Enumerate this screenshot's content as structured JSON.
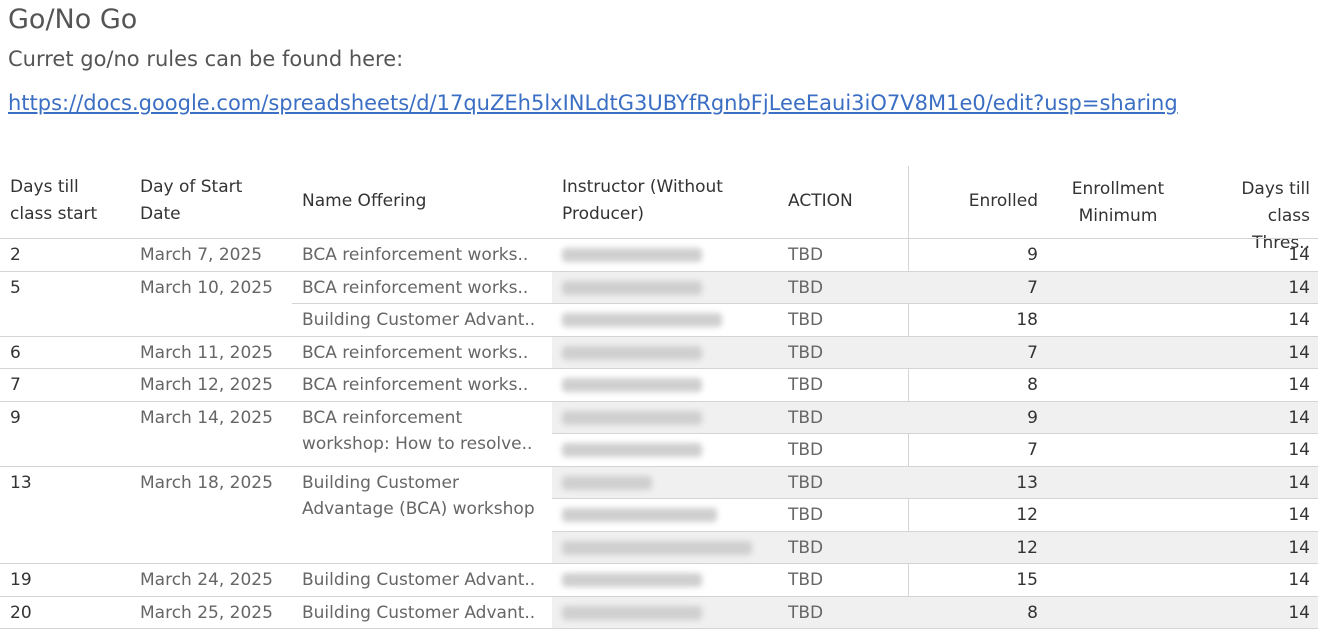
{
  "title": "Go/No Go",
  "subtitle": "Curret go/no rules can be found here:",
  "link_text": "https://docs.google.com/spreadsheets/d/17quZEh5lxINLdtG3UBYfRgnbFjLeeEaui3iO7V8M1e0/edit?usp=sharing",
  "table": {
    "headers": {
      "days_till_class_start": "Days till class start",
      "day_of_start_date": "Day of Start Date",
      "name_offering": "Name Offering",
      "instructor": "Instructor (Without Producer)",
      "action": "ACTION",
      "enrolled": "Enrolled",
      "enrollment_minimum": "Enrollment Minimum",
      "days_till_class_threshold": "Days till class Thres.."
    },
    "groups": [
      {
        "days": "2",
        "date": "March 7, 2025"
      },
      {
        "days": "5",
        "date": "March 10, 2025"
      },
      {
        "days": "6",
        "date": "March 11, 2025"
      },
      {
        "days": "7",
        "date": "March 12, 2025"
      },
      {
        "days": "9",
        "date": "March 14, 2025"
      },
      {
        "days": "13",
        "date": "March 18, 2025"
      },
      {
        "days": "19",
        "date": "March 24, 2025"
      },
      {
        "days": "20",
        "date": "March 25, 2025"
      }
    ],
    "offerings": [
      "BCA reinforcement works..",
      "BCA reinforcement works..",
      "Building Customer Advant..",
      "BCA reinforcement works..",
      "BCA reinforcement works..",
      "BCA reinforcement workshop: How to resolve..",
      "Building Customer Advantage (BCA) workshop",
      "Building Customer Advant..",
      "Building Customer Advant.."
    ],
    "rows": [
      {
        "action": "TBD",
        "enrolled": "9",
        "threshold": "14"
      },
      {
        "action": "TBD",
        "enrolled": "7",
        "threshold": "14"
      },
      {
        "action": "TBD",
        "enrolled": "18",
        "threshold": "14"
      },
      {
        "action": "TBD",
        "enrolled": "7",
        "threshold": "14"
      },
      {
        "action": "TBD",
        "enrolled": "8",
        "threshold": "14"
      },
      {
        "action": "TBD",
        "enrolled": "9",
        "threshold": "14"
      },
      {
        "action": "TBD",
        "enrolled": "7",
        "threshold": "14"
      },
      {
        "action": "TBD",
        "enrolled": "13",
        "threshold": "14"
      },
      {
        "action": "TBD",
        "enrolled": "12",
        "threshold": "14"
      },
      {
        "action": "TBD",
        "enrolled": "12",
        "threshold": "14"
      },
      {
        "action": "TBD",
        "enrolled": "15",
        "threshold": "14"
      },
      {
        "action": "TBD",
        "enrolled": "8",
        "threshold": "14"
      }
    ]
  }
}
